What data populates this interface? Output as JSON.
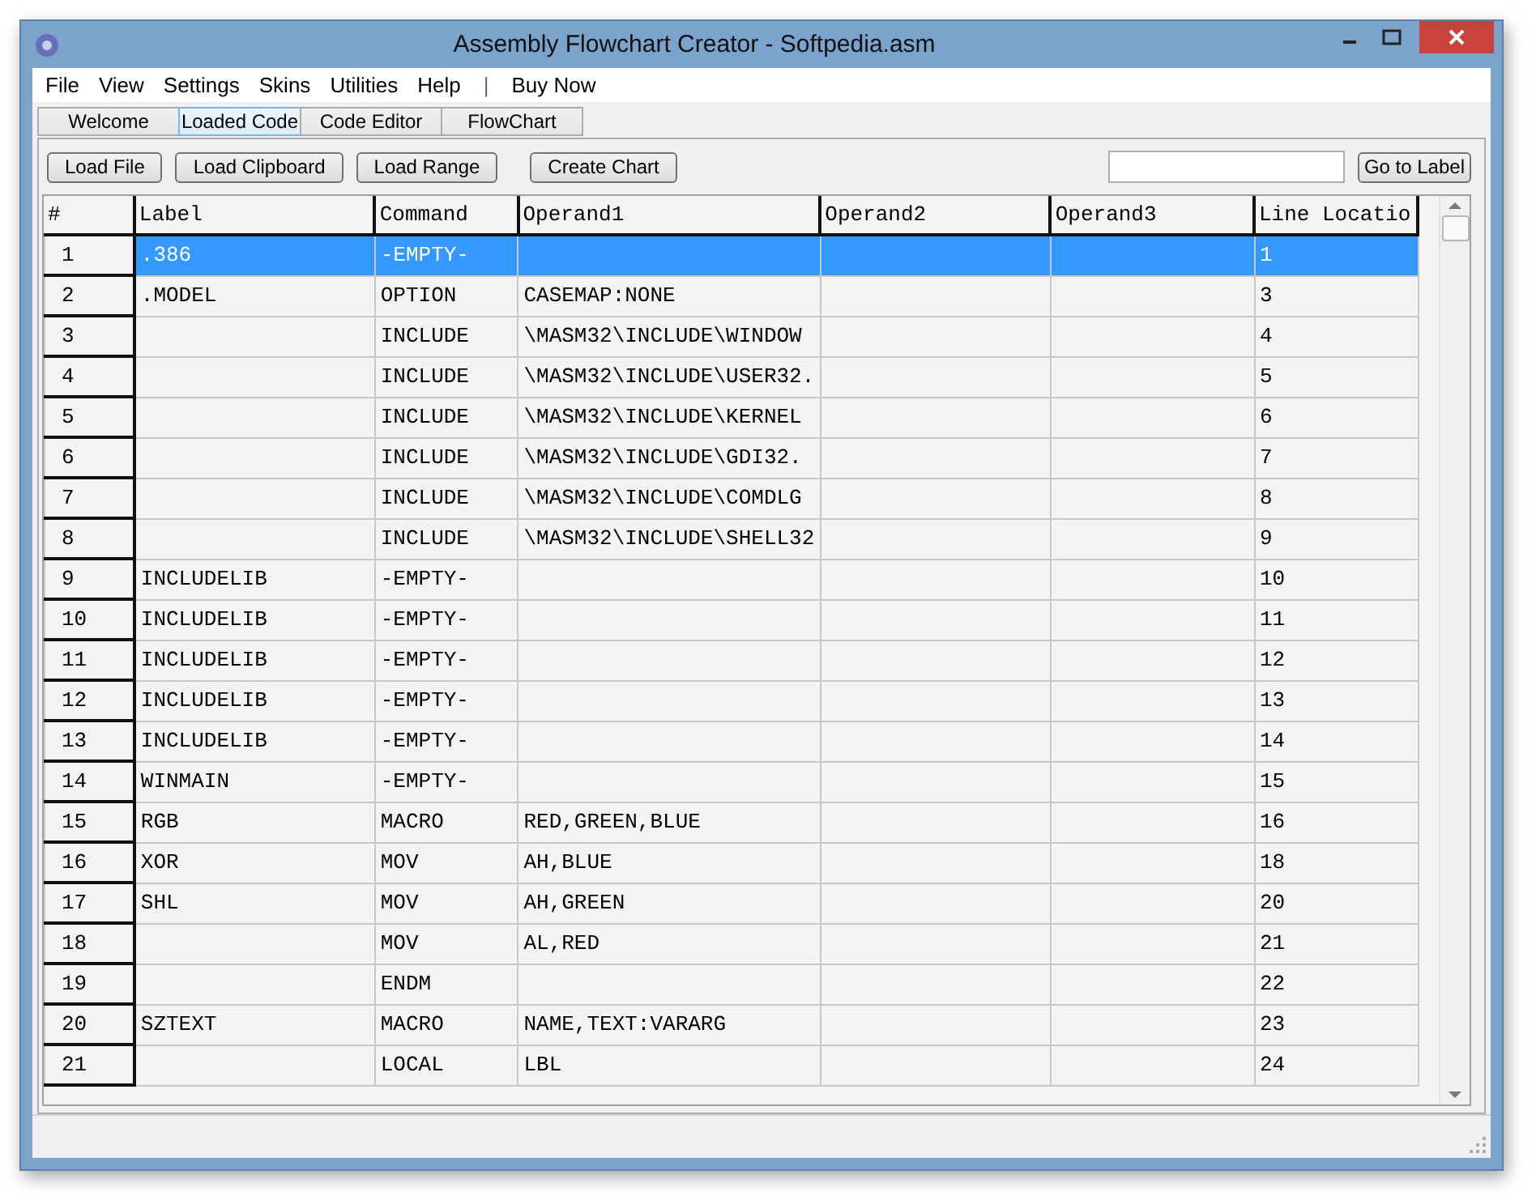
{
  "window": {
    "title": "Assembly Flowchart Creator - Softpedia.asm"
  },
  "menu": [
    {
      "label": "File"
    },
    {
      "label": "View"
    },
    {
      "label": "Settings"
    },
    {
      "label": "Skins"
    },
    {
      "label": "Utilities"
    },
    {
      "label": "Help"
    },
    {
      "label": "|",
      "kind": "separator"
    },
    {
      "label": "Buy Now"
    }
  ],
  "tabs": [
    {
      "label": "Welcome",
      "selected": false
    },
    {
      "label": "Loaded Code",
      "selected": true
    },
    {
      "label": "Code Editor",
      "selected": false
    },
    {
      "label": "FlowChart",
      "selected": false
    }
  ],
  "toolbar": {
    "buttons": [
      "Load File",
      "Load Clipboard",
      "Load Range",
      "Create Chart"
    ],
    "go_button": "Go to Label"
  },
  "table": {
    "columns": [
      "#",
      "Label",
      "Command",
      "Operand1",
      "Operand2",
      "Operand3",
      "Line Locatio"
    ],
    "rows": [
      {
        "cells": [
          "1",
          ".386",
          "-EMPTY-",
          "",
          "",
          "",
          "1"
        ],
        "selected": true
      },
      {
        "cells": [
          "2",
          ".MODEL",
          "OPTION",
          "CASEMAP:NONE",
          "",
          "",
          "3"
        ],
        "selected": false
      },
      {
        "cells": [
          "3",
          "",
          "INCLUDE",
          "\\MASM32\\INCLUDE\\WINDOW",
          "",
          "",
          "4"
        ],
        "selected": false
      },
      {
        "cells": [
          "4",
          "",
          "INCLUDE",
          "\\MASM32\\INCLUDE\\USER32.",
          "",
          "",
          "5"
        ],
        "selected": false
      },
      {
        "cells": [
          "5",
          "",
          "INCLUDE",
          "\\MASM32\\INCLUDE\\KERNEL",
          "",
          "",
          "6"
        ],
        "selected": false
      },
      {
        "cells": [
          "6",
          "",
          "INCLUDE",
          "\\MASM32\\INCLUDE\\GDI32.",
          "",
          "",
          "7"
        ],
        "selected": false
      },
      {
        "cells": [
          "7",
          "",
          "INCLUDE",
          "\\MASM32\\INCLUDE\\COMDLG",
          "",
          "",
          "8"
        ],
        "selected": false
      },
      {
        "cells": [
          "8",
          "",
          "INCLUDE",
          "\\MASM32\\INCLUDE\\SHELL32",
          "",
          "",
          "9"
        ],
        "selected": false
      },
      {
        "cells": [
          "9",
          "INCLUDELIB",
          "-EMPTY-",
          "",
          "",
          "",
          "10"
        ],
        "selected": false
      },
      {
        "cells": [
          "10",
          "INCLUDELIB",
          "-EMPTY-",
          "",
          "",
          "",
          "11"
        ],
        "selected": false
      },
      {
        "cells": [
          "11",
          "INCLUDELIB",
          "-EMPTY-",
          "",
          "",
          "",
          "12"
        ],
        "selected": false
      },
      {
        "cells": [
          "12",
          "INCLUDELIB",
          "-EMPTY-",
          "",
          "",
          "",
          "13"
        ],
        "selected": false
      },
      {
        "cells": [
          "13",
          "INCLUDELIB",
          "-EMPTY-",
          "",
          "",
          "",
          "14"
        ],
        "selected": false
      },
      {
        "cells": [
          "14",
          "WINMAIN",
          "-EMPTY-",
          "",
          "",
          "",
          "15"
        ],
        "selected": false
      },
      {
        "cells": [
          "15",
          "RGB",
          "MACRO",
          "RED,GREEN,BLUE",
          "",
          "",
          "16"
        ],
        "selected": false
      },
      {
        "cells": [
          "16",
          "XOR",
          "MOV",
          "AH,BLUE",
          "",
          "",
          "18"
        ],
        "selected": false
      },
      {
        "cells": [
          "17",
          "SHL",
          "MOV",
          "AH,GREEN",
          "",
          "",
          "20"
        ],
        "selected": false
      },
      {
        "cells": [
          "18",
          "",
          "MOV",
          "AL,RED",
          "",
          "",
          "21"
        ],
        "selected": false
      },
      {
        "cells": [
          "19",
          "",
          "ENDM",
          "",
          "",
          "",
          "22"
        ],
        "selected": false
      },
      {
        "cells": [
          "20",
          "SZTEXT",
          "MACRO",
          "NAME,TEXT:VARARG",
          "",
          "",
          "23"
        ],
        "selected": false
      },
      {
        "cells": [
          "21",
          "",
          "LOCAL",
          "LBL",
          "",
          "",
          "24"
        ],
        "selected": false
      }
    ]
  }
}
